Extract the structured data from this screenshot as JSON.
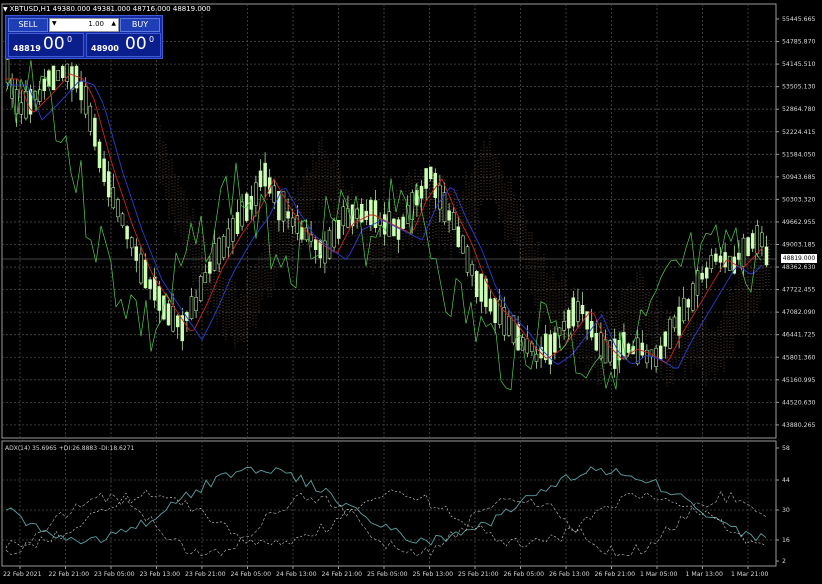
{
  "header": {
    "symbol_line": "XBTUSD,H1  49380.000 49381.000 48716.000 48819.000"
  },
  "trade_panel": {
    "sell_label": "SELL",
    "buy_label": "BUY",
    "lot_value": "1.00",
    "sell_small": "48819",
    "sell_big": "00",
    "sell_sup": "0",
    "buy_small": "48900",
    "buy_big": "00",
    "buy_sup": "0"
  },
  "current_price": "48819.000",
  "price_axis": [
    "55445.665",
    "54785.870",
    "54145.510",
    "53505.130",
    "52864.780",
    "52224.415",
    "51584.050",
    "50943.685",
    "50303.320",
    "49662.955",
    "49003.185",
    "48362.630",
    "47722.455",
    "47082.090",
    "46441.725",
    "45801.360",
    "45160.995",
    "44520.630",
    "43880.265"
  ],
  "adx": {
    "label": "ADX(14) 35.6965 +DI:26.8883 -DI:18.6271",
    "axis": [
      "58",
      "44",
      "30",
      "16",
      "2"
    ]
  },
  "time_axis": [
    "22 Feb 2021",
    "22 Feb 21:00",
    "23 Feb 05:00",
    "23 Feb 13:00",
    "23 Feb 21:00",
    "24 Feb 05:00",
    "24 Feb 13:00",
    "24 Feb 21:00",
    "25 Feb 05:00",
    "25 Feb 13:00",
    "25 Feb 21:00",
    "26 Feb 05:00",
    "26 Feb 13:00",
    "26 Feb 21:00",
    "1 Mar 05:00",
    "1 Mar 13:00",
    "1 Mar 21:00"
  ],
  "colors": {
    "bg": "#000000",
    "candle": "#ccffb3",
    "grid": "#4a4a4a",
    "ma_red": "#d02020",
    "ma_blue": "#2a3cd8",
    "green_line": "#4fd04f",
    "cloud": "#b08060",
    "adx_line": "#5aa0a0"
  }
}
